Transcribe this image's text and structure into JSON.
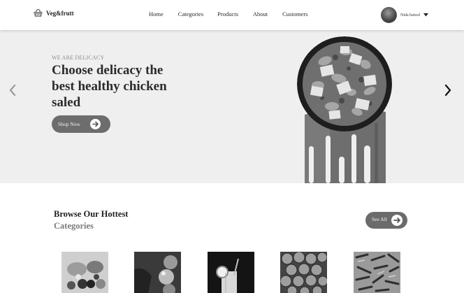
{
  "nav": {
    "brand": "Veg&frutt",
    "brand_icon": "basket-icon",
    "links": [
      "Home",
      "Categories",
      "Products",
      "About",
      "Customers"
    ],
    "user_name": "Nida batool",
    "user_menu_icon": "caret-down-icon"
  },
  "hero": {
    "kicker": "WE ARE DELICACY",
    "headline": "Choose delicacy the best healthy chicken saled",
    "cta_label": "Shop Now",
    "cta_icon": "arrow-right-icon",
    "prev_icon": "chevron-left-icon",
    "next_icon": "chevron-right-icon"
  },
  "categories": {
    "title": "Browse Our Hottest",
    "subtitle": "Categories",
    "see_all_label": "See All",
    "see_all_icon": "arrow-right-icon",
    "items": [
      {
        "image": "fruit-assortment-photo"
      },
      {
        "image": "tomatoes-photo"
      },
      {
        "image": "juice-glass-photo"
      },
      {
        "image": "walnuts-photo"
      },
      {
        "image": "dried-chilies-photo"
      }
    ]
  },
  "colors": {
    "hero_bg": "#efefef",
    "button": "#6d6d6d",
    "text_dark": "#1f1f1f",
    "text_muted": "#7a7a7a"
  }
}
